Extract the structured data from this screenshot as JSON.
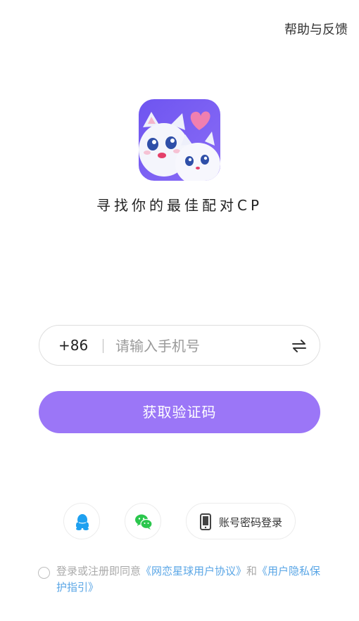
{
  "header": {
    "help_label": "帮助与反馈"
  },
  "branding": {
    "slogan": "寻找你的最佳配对CP"
  },
  "login_form": {
    "country_code": "+86",
    "phone_placeholder": "请输入手机号",
    "phone_value": "",
    "get_code_label": "获取验证码"
  },
  "alt_login": {
    "qq_icon": "qq-icon",
    "wechat_icon": "wechat-icon",
    "account_label": "账号密码登录"
  },
  "agreement": {
    "prefix": "登录或注册即同意",
    "user_agreement": "《网恋星球用户协议》",
    "conjunction": "和",
    "privacy_guide": "《用户隐私保护指引》"
  },
  "colors": {
    "accent": "#9b76f7",
    "link": "#5aa6e6",
    "qq": "#1ea0f0",
    "wechat": "#2ac64c"
  }
}
